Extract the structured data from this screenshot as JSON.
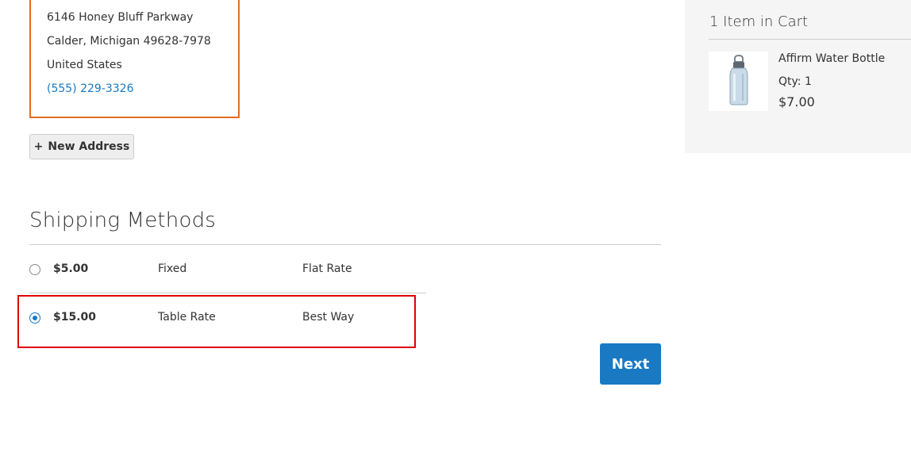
{
  "address": {
    "street": "6146 Honey Bluff Parkway",
    "city_line": "Calder, Michigan 49628-7978",
    "country": "United States",
    "phone": "(555) 229-3326"
  },
  "new_address_button": {
    "icon": "+",
    "label": "New Address"
  },
  "shipping": {
    "title": "Shipping Methods",
    "methods": [
      {
        "price": "$5.00",
        "type": "Fixed",
        "carrier": "Flat Rate",
        "selected": false
      },
      {
        "price": "$15.00",
        "type": "Table Rate",
        "carrier": "Best Way",
        "selected": true
      }
    ]
  },
  "next_button": {
    "label": "Next"
  },
  "cart": {
    "title": "1 Item in Cart",
    "items": [
      {
        "name": "Affirm Water Bottle",
        "qty": "Qty: 1",
        "price": "$7.00",
        "image_icon": "water-bottle-image"
      }
    ]
  },
  "colors": {
    "accent": "#1979c3",
    "selected_card_border": "#e06e1f",
    "highlight": "#e00000",
    "sidebar_bg": "#f5f5f5"
  }
}
